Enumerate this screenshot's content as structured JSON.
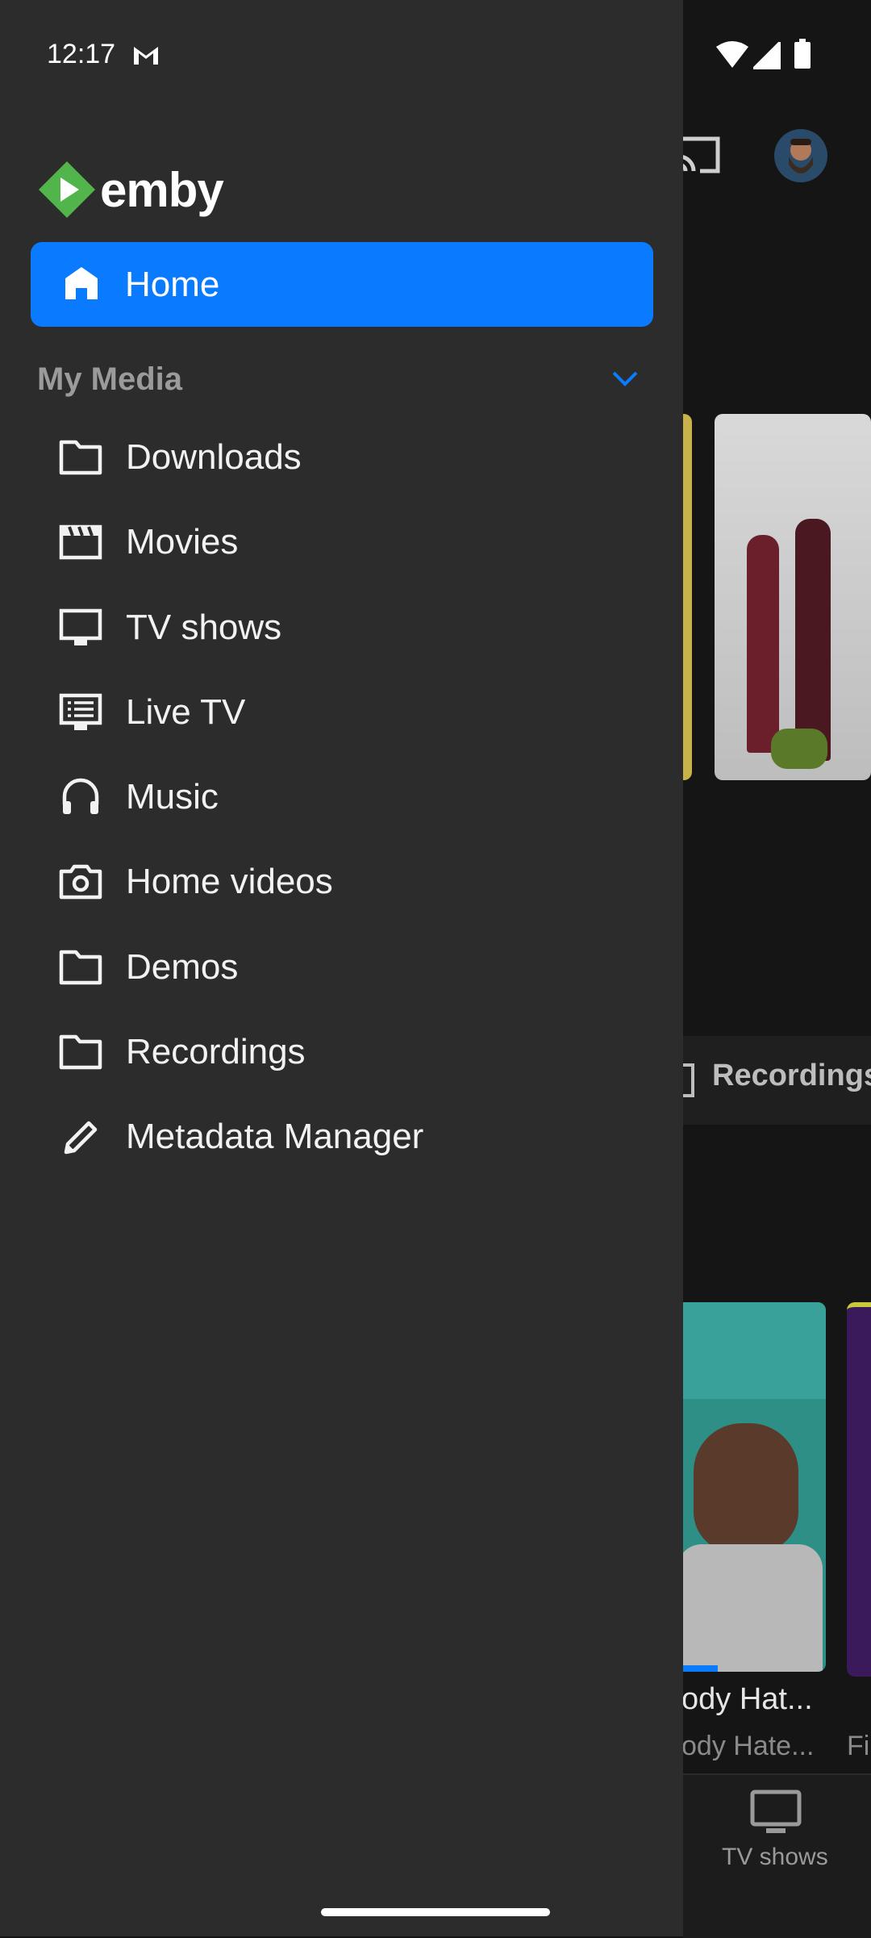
{
  "status_bar": {
    "time": "12:17"
  },
  "drawer": {
    "logo_text": "emby",
    "home_label": "Home",
    "section_label": "My Media",
    "items": [
      {
        "label": "Downloads",
        "icon": "folder-icon"
      },
      {
        "label": "Movies",
        "icon": "clapperboard-icon"
      },
      {
        "label": "TV shows",
        "icon": "tv-icon"
      },
      {
        "label": "Live TV",
        "icon": "live-tv-guide-icon"
      },
      {
        "label": "Music",
        "icon": "headphones-icon"
      },
      {
        "label": "Home videos",
        "icon": "camera-icon"
      },
      {
        "label": "Demos",
        "icon": "folder-icon"
      },
      {
        "label": "Recordings",
        "icon": "folder-icon"
      },
      {
        "label": "Metadata Manager",
        "icon": "pencil-icon"
      }
    ]
  },
  "background": {
    "section_button": "Recordings",
    "item_title": "ody Hat...",
    "item_subtitle": "ody Hate...",
    "item_subtitle_2": "Fi",
    "nav_label": "TV shows"
  },
  "colors": {
    "accent": "#0a7bff",
    "drawer_bg": "#2c2c2c",
    "logo_green": "#52b54b"
  }
}
